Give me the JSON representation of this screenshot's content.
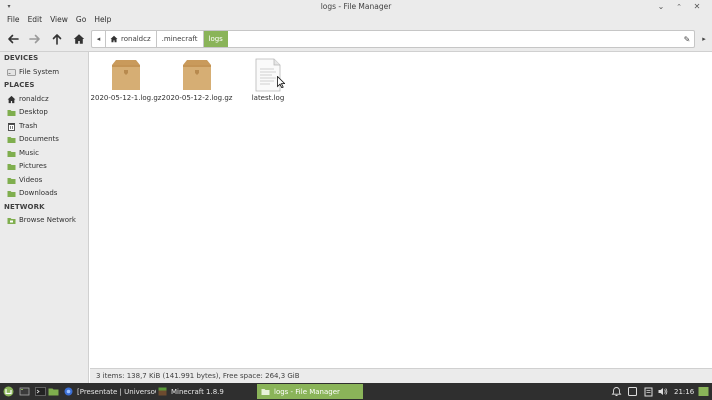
{
  "window": {
    "title": "logs - File Manager"
  },
  "menubar": [
    "File",
    "Edit",
    "View",
    "Go",
    "Help"
  ],
  "toolbar": {
    "back_icon": "arrow-left-icon",
    "forward_icon": "arrow-right-icon",
    "up_icon": "arrow-up-icon",
    "home_icon": "home-icon"
  },
  "pathbar": {
    "segments": [
      {
        "label": "ronaldcz",
        "icon": "home-icon"
      },
      {
        "label": ".minecraft"
      },
      {
        "label": "logs",
        "active": true
      }
    ]
  },
  "sidebar": {
    "devices_header": "DEVICES",
    "devices": [
      {
        "label": "File System",
        "icon": "drive-icon"
      }
    ],
    "places_header": "PLACES",
    "places": [
      {
        "label": "ronaldcz",
        "icon": "home-icon"
      },
      {
        "label": "Desktop",
        "icon": "folder-icon"
      },
      {
        "label": "Trash",
        "icon": "trash-icon"
      },
      {
        "label": "Documents",
        "icon": "folder-icon"
      },
      {
        "label": "Music",
        "icon": "folder-icon"
      },
      {
        "label": "Pictures",
        "icon": "folder-icon"
      },
      {
        "label": "Videos",
        "icon": "folder-icon"
      },
      {
        "label": "Downloads",
        "icon": "folder-icon"
      }
    ],
    "network_header": "NETWORK",
    "network": [
      {
        "label": "Browse Network",
        "icon": "network-icon"
      }
    ]
  },
  "files": [
    {
      "name": "2020-05-12-1.log.gz",
      "icon": "archive-icon"
    },
    {
      "name": "2020-05-12-2.log.gz",
      "icon": "archive-icon"
    },
    {
      "name": "latest.log",
      "icon": "text-file-icon"
    }
  ],
  "statusbar": {
    "text": "3 items: 138,7 KiB (141.991 bytes), Free space: 264,3 GiB"
  },
  "taskbar": {
    "windows": [
      {
        "label": "[Presentate | UniversoCraf...",
        "icon": "browser-icon"
      },
      {
        "label": "Minecraft 1.8.9",
        "icon": "minecraft-icon"
      },
      {
        "label": "logs - File Manager",
        "icon": "folder-icon",
        "active": true
      }
    ],
    "clock": "21:16"
  },
  "colors": {
    "accent": "#8ab459",
    "chrome": "#ebebeb",
    "folder_box": "#d6ae74",
    "taskbar": "#2f2f2f"
  }
}
